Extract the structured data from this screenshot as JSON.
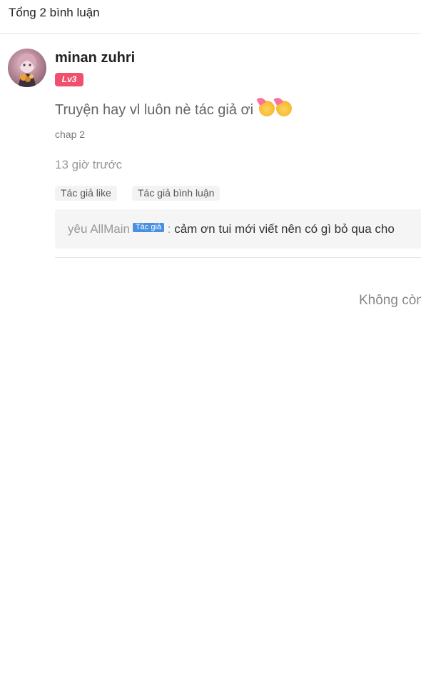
{
  "header": {
    "title": "Tổng 2 bình luận"
  },
  "comment": {
    "username": "minan zuhri",
    "level": "Lv3",
    "text": "Truyện hay vl luôn nè tác giả ơi",
    "emojis": [
      "partying-face-emoji",
      "partying-face-emoji"
    ],
    "chapter": "chap 2",
    "time": "13 giờ trước",
    "tags": {
      "like": "Tác giả like",
      "reply": "Tác giả bình luận"
    },
    "reply": {
      "author": "yêu AllMain",
      "badge": "Tác giả",
      "separator": " : ",
      "text": "cảm ơn tui mới viết  nên có gì bỏ qua cho"
    }
  },
  "footer": {
    "end_text": "Không còn"
  },
  "colors": {
    "level_badge": "#f0506e",
    "author_badge": "#4a90e2",
    "reply_background": "#f5f5f5"
  }
}
